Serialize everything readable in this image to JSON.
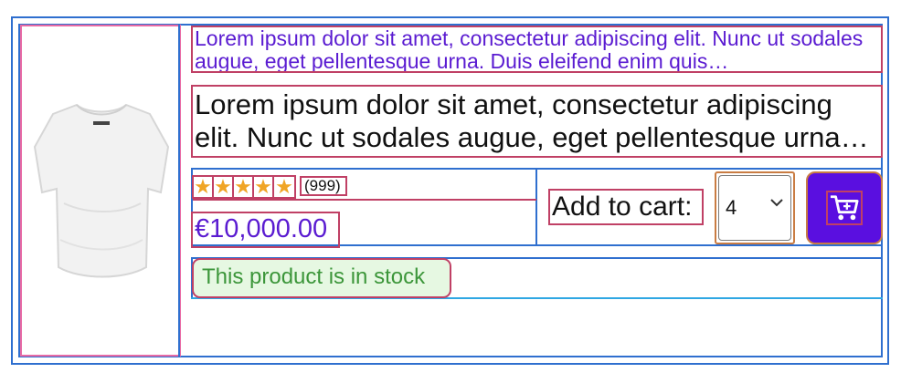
{
  "product": {
    "image_alt": "white t-shirt",
    "title_short": "Lorem ipsum dolor sit amet, consectetur adipiscing elit. Nunc ut sodales augue, eget pellentesque urna. Duis eleifend enim quis…",
    "title_long": "Lorem ipsum dolor sit amet, consectetur adipiscing elit. Nunc ut sodales augue, eget pellentesque urna…",
    "rating": {
      "stars": 5,
      "max": 5,
      "count_label": "(999)"
    },
    "price": "€10,000.00",
    "cart": {
      "add_label": "Add to cart:",
      "quantity": "4",
      "button_icon": "add-to-cart-icon"
    },
    "stock_text": "This product is in stock"
  },
  "colors": {
    "accent": "#5a0fe0",
    "price": "#5a1bd1",
    "star": "#f0a526",
    "stock_bg": "#e6f8e2",
    "stock_text": "#3c963a",
    "frame": "#2f6fcf",
    "debug_outline": "#c04065"
  }
}
